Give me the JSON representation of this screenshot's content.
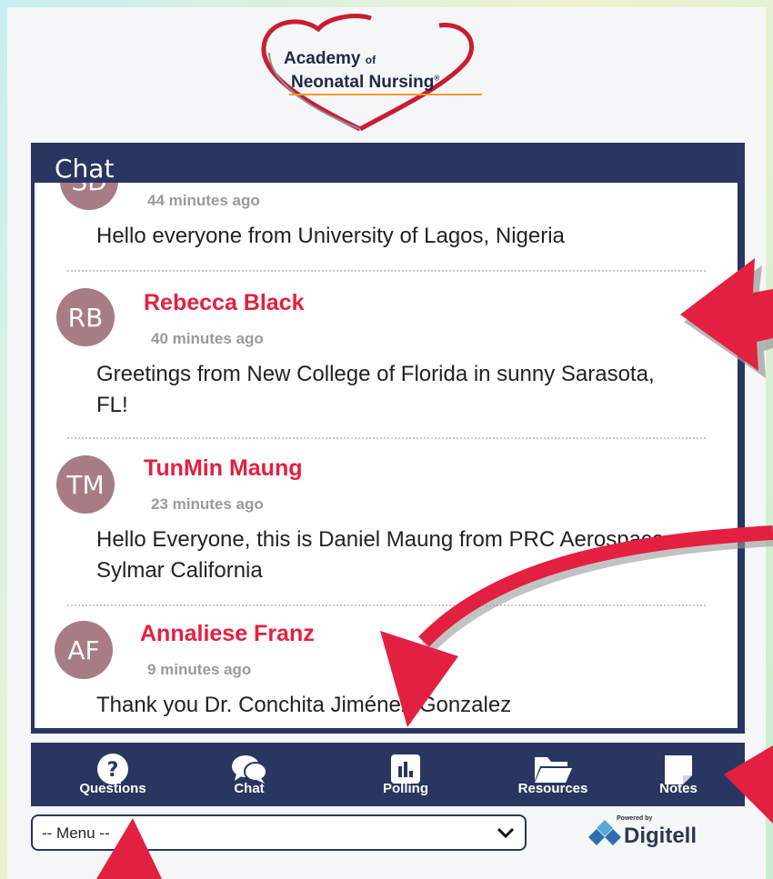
{
  "logo": {
    "line1": "Academy",
    "of": "of",
    "line2": "Neonatal Nursing",
    "reg": "®"
  },
  "chat": {
    "title": "Chat",
    "messages": [
      {
        "initials": "SD",
        "author": "",
        "time": "44 minutes ago",
        "text": "Hello everyone from University of Lagos, Nigeria"
      },
      {
        "initials": "RB",
        "author": "Rebecca Black",
        "time": "40 minutes ago",
        "text": "Greetings from New College of Florida in sunny Sarasota, FL!"
      },
      {
        "initials": "TM",
        "author": "TunMin Maung",
        "time": "23 minutes ago",
        "text": "Hello Everyone, this is Daniel Maung from PRC Aerospace, Sylmar California"
      },
      {
        "initials": "AF",
        "author": "Annaliese Franz",
        "time": "9 minutes ago",
        "text": "Thank you Dr. Conchita Jiménez-Gonzalez"
      }
    ]
  },
  "nav": {
    "items": [
      {
        "label": "Questions",
        "icon": "question-icon"
      },
      {
        "label": "Chat",
        "icon": "chat-bubbles-icon"
      },
      {
        "label": "Polling",
        "icon": "bar-chart-icon"
      },
      {
        "label": "Resources",
        "icon": "folder-icon"
      },
      {
        "label": "Notes",
        "icon": "note-icon"
      }
    ]
  },
  "menu": {
    "selected": "-- Menu --"
  },
  "branding": {
    "powered_by": "Powered by",
    "name": "Digitell"
  },
  "colors": {
    "panel": "#293661",
    "author": "#e3203f",
    "avatar": "#a87c85",
    "arrow": "#e3203f"
  }
}
